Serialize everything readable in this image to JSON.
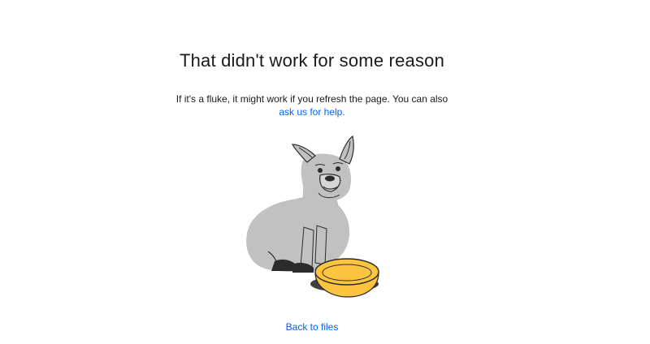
{
  "error": {
    "title": "That didn't work for some reason",
    "message_prefix": "If it's a fluke, it might work if you refresh the page. You can also",
    "help_link": "ask us for help.",
    "back_link": "Back to files"
  },
  "colors": {
    "link": "#0061fe",
    "text": "#1e1919",
    "dog_gray": "#c1c1c1",
    "bowl_yellow": "#fcc43f"
  },
  "illustration": {
    "subject": "dog-with-empty-bowl-illustration"
  }
}
